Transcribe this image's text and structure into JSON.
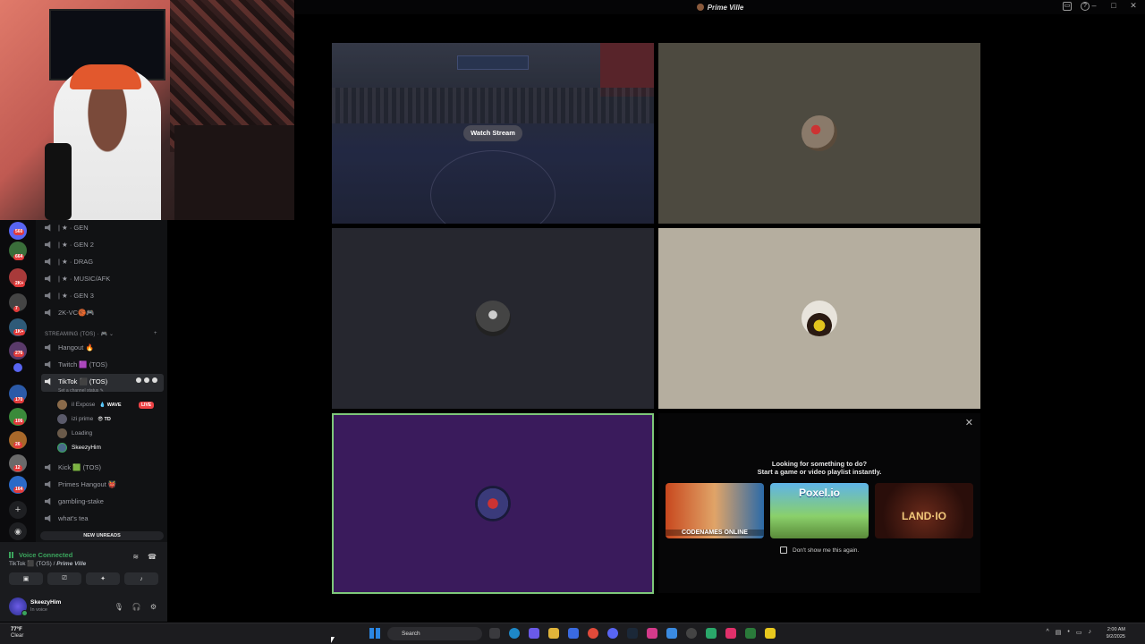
{
  "window": {
    "server_title": "Prime Ville"
  },
  "stream": {
    "watch_label": "Watch Stream"
  },
  "sidebar": {
    "voice_channels": [
      {
        "label": "| ★ · GEN"
      },
      {
        "label": "| ★ · GEN 2"
      },
      {
        "label": "| ★ · DRAG"
      },
      {
        "label": "| ★ · MUSIC/AFK"
      },
      {
        "label": "| ★ · GEN 3"
      },
      {
        "label": "2K-VC🏀🎮"
      }
    ],
    "category": "STREAMING (TOS) · 🎮 ⌄",
    "channels_after": [
      {
        "label": "Hangout 🔥"
      },
      {
        "label": "Twitch 🟪 (TOS)"
      }
    ],
    "active_channel": {
      "label": "TikTok ⬛ (TOS)",
      "status": "Set a channel status ✎"
    },
    "members": [
      {
        "name": "il Expose",
        "tag": "💧 WAVE"
      },
      {
        "name": "izi prime",
        "tag": "😎 TD"
      },
      {
        "name": "Loading",
        "tag": ""
      },
      {
        "name": "SkeezyHim",
        "tag": ""
      }
    ],
    "live_badge": "LIVE",
    "channels_bottom": [
      {
        "label": "Kick 🟩 (TOS)"
      },
      {
        "label": "Primes Hangout 👹"
      },
      {
        "label": "gambling-stake"
      },
      {
        "label": "what's tea"
      }
    ],
    "new_unreads": "NEW UNREADS",
    "rail_badges": [
      "560",
      "664",
      "2K+",
      "7",
      "1K+",
      "276",
      "170",
      "106",
      "26",
      "12",
      "164"
    ]
  },
  "voice_panel": {
    "title": "Voice Connected",
    "channel": "TikTok ⬛ (TOS) / ",
    "server": "Prime Ville"
  },
  "user": {
    "name": "SkeezyHim",
    "status": "In voice"
  },
  "activity": {
    "line1": "Looking for something to do?",
    "line2": "Start a game or video playlist instantly.",
    "cards": [
      {
        "label": "CODENAMES ONLINE"
      },
      {
        "label": "Poxel.io"
      },
      {
        "label": "LAND·IO"
      }
    ],
    "dont_show": "Don't show me this again."
  },
  "taskbar": {
    "weather_temp": "77°F",
    "weather_desc": "Clear",
    "search": "Search",
    "time": "2:00 AM",
    "date": "9/2/2025"
  }
}
